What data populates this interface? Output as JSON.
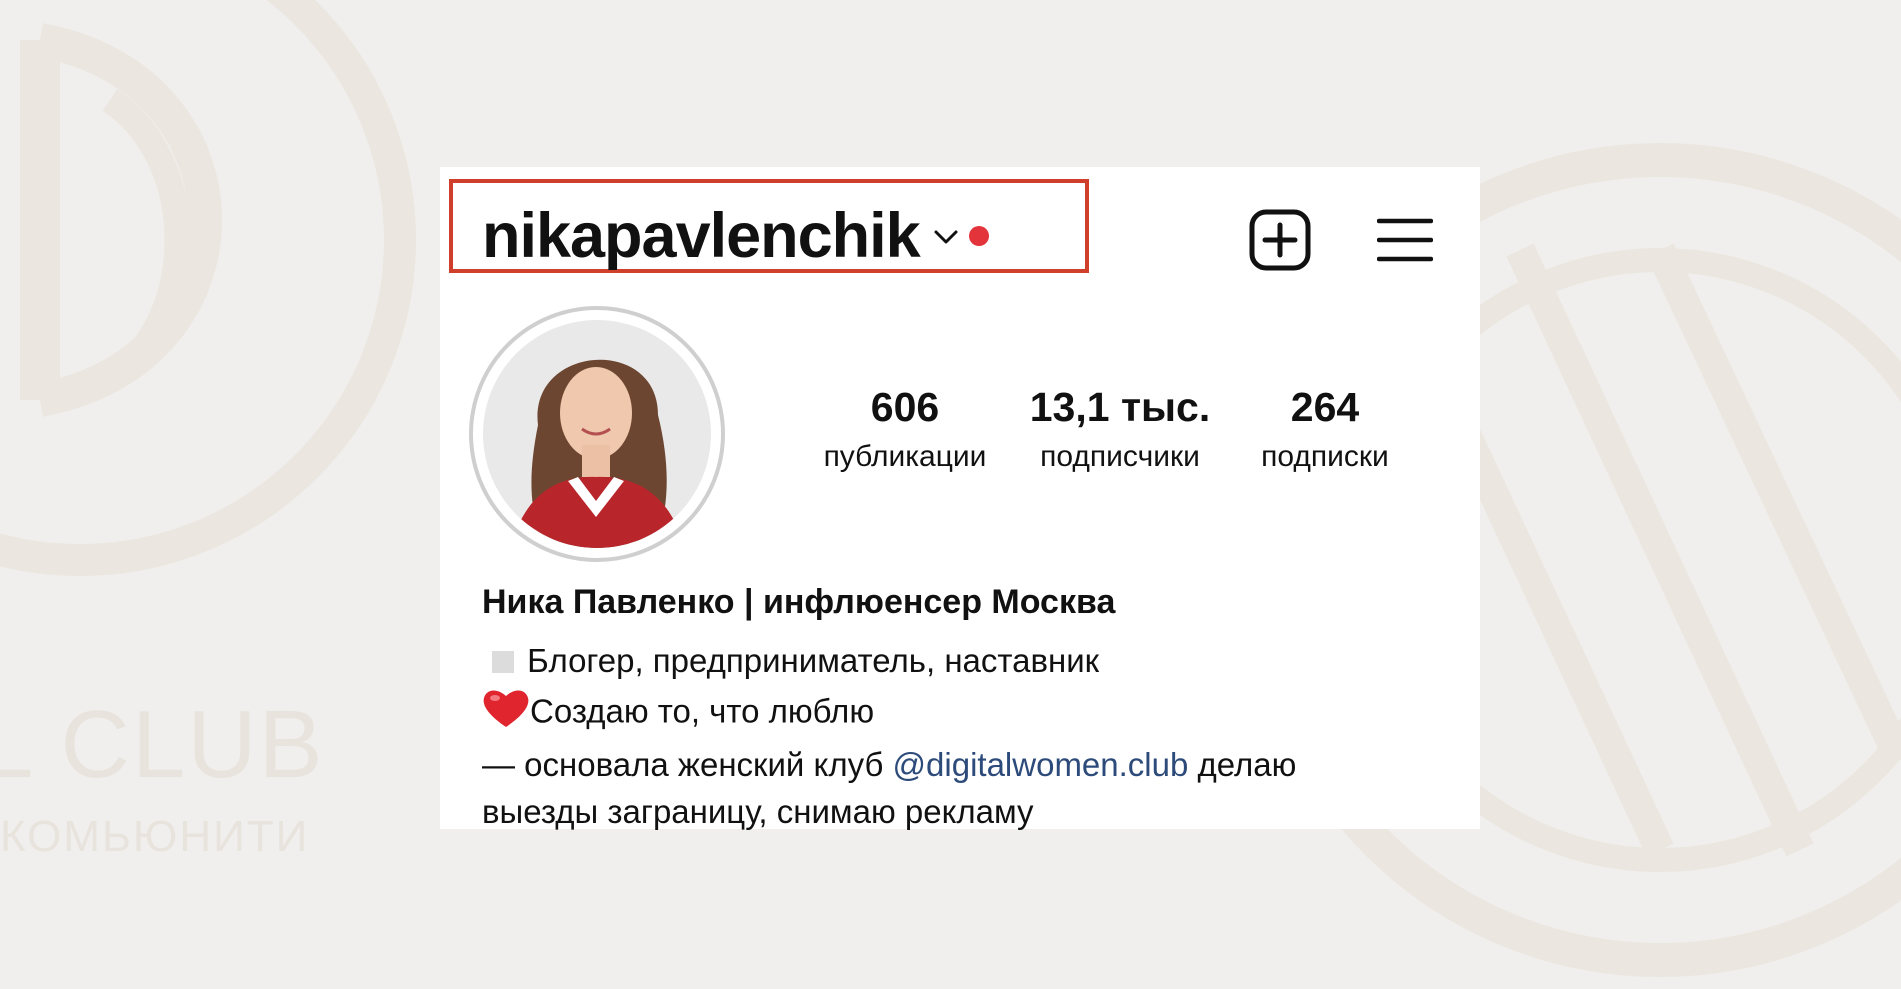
{
  "background": {
    "club_text": "L CLUB",
    "community_text": "КОМЬЮНИТИ",
    "decoration_color": "#e8e2da"
  },
  "profile": {
    "username": "nikapavlenchik",
    "notification_dot_color": "#e4343b",
    "highlight_color": "#cf3f2c",
    "icons": {
      "chevron": "chevron-down-icon",
      "new_post": "plus-square-icon",
      "menu": "hamburger-menu-icon"
    },
    "stats": [
      {
        "value": "606",
        "label": "публикации"
      },
      {
        "value": "13,1 тыс.",
        "label": "подписчики"
      },
      {
        "value": "264",
        "label": "подписки"
      }
    ],
    "bio": {
      "name": "Ника Павленко | инфлюенсер Москва",
      "line1": "Блогер, предприниматель, наставник",
      "line2": "Создаю то, что люблю",
      "line3_before": "— основала женский клуб ",
      "line3_mention": "@digitalwomen.club",
      "line3_after": " делаю",
      "line4": "выезды заграницу, снимаю рекламу",
      "mention_color": "#2d4b7a"
    }
  }
}
